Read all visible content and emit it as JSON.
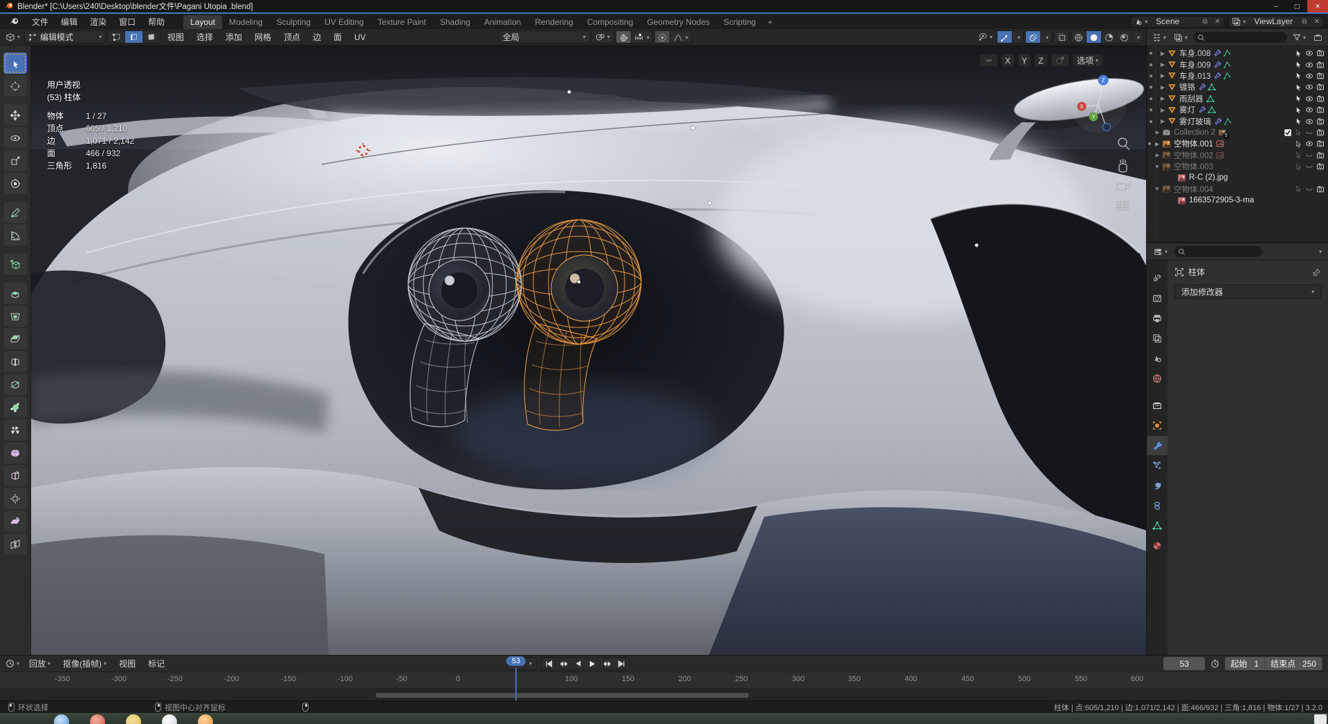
{
  "window": {
    "title": "Blender* [C:\\Users\\240\\Desktop\\blender文件\\Pagani Utopia .blend]"
  },
  "colors": {
    "accent_blue": "#4772b3",
    "selected_wire_orange": "#f29f45",
    "mesh_icon_orange": "#e0933f",
    "modifier_icon_blue": "#7d87e8",
    "data_icon_green": "#3fd0a0",
    "image_icon_pink": "#d07579",
    "close_button_red": "#c13a30"
  },
  "topbar": {
    "menus": [
      "文件",
      "编辑",
      "渲染",
      "窗口",
      "帮助"
    ],
    "tabs": [
      "Layout",
      "Modeling",
      "Sculpting",
      "UV Editing",
      "Texture Paint",
      "Shading",
      "Animation",
      "Rendering",
      "Compositing",
      "Geometry Nodes",
      "Scripting"
    ],
    "active_tab": "Layout",
    "tab_plus": "+",
    "scene_name": "Scene",
    "view_layer_name": "ViewLayer"
  },
  "viewport_header": {
    "mode": "编辑模式",
    "menus": [
      "视图",
      "选择",
      "添加",
      "网格",
      "顶点",
      "边",
      "面",
      "UV"
    ],
    "orientation": "全局",
    "axis_buttons": [
      "X",
      "Y",
      "Z"
    ],
    "options_label": "选项"
  },
  "viewport_overlay": {
    "view_name": "用户透视",
    "object_name": "(53) 柱体",
    "stats": [
      {
        "label": "物体",
        "value": "1 / 27"
      },
      {
        "label": "顶点",
        "value": "605 / 1,210"
      },
      {
        "label": "边",
        "value": "1,071 / 2,142"
      },
      {
        "label": "面",
        "value": "466 / 932"
      },
      {
        "label": "三角形",
        "value": "1,816"
      }
    ]
  },
  "outliner": {
    "items": [
      {
        "name": "车身.008"
      },
      {
        "name": "车身.009"
      },
      {
        "name": "车身.013"
      },
      {
        "name": "镀铬"
      },
      {
        "name": "雨刮器"
      },
      {
        "name": "雾灯"
      },
      {
        "name": "雾灯玻璃"
      },
      {
        "name": "Collection 2",
        "badge": "5"
      },
      {
        "name": "空物体.001"
      },
      {
        "name": "空物体.002"
      },
      {
        "name": "空物体.003"
      },
      {
        "name": "R-C (2).jpg"
      },
      {
        "name": "空物体.004"
      },
      {
        "name": "1663572905-3-ma"
      }
    ]
  },
  "properties": {
    "breadcrumb": "柱体",
    "add_modifier_label": "添加修改器"
  },
  "timeline": {
    "menus": [
      "回放",
      "抠像(插帧)",
      "视图",
      "标记"
    ],
    "current_frame": "53",
    "start_label": "起始",
    "start_value": "1",
    "end_label": "结束点",
    "end_value": "250",
    "ruler": [
      "-350",
      "-300",
      "-250",
      "-200",
      "-150",
      "-100",
      "-50",
      "0",
      "100",
      "150",
      "200",
      "250",
      "300",
      "350",
      "400",
      "450",
      "500",
      "550",
      "600"
    ]
  },
  "statusbar": {
    "hint_left": "环状选择",
    "hint_middle": "视图中心对齐鼠标",
    "stats": "柱体 | 点:605/1,210 | 边:1,071/2,142 | 面:466/932 | 三角:1,816 | 物体:1/27 | 3.2.0"
  }
}
